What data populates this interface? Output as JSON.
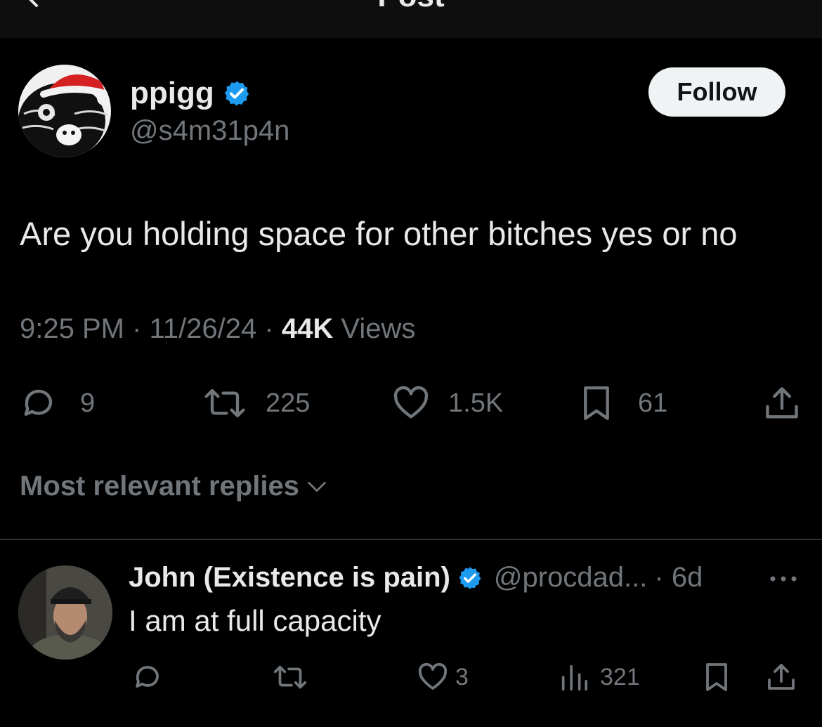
{
  "header": {
    "title": "Post"
  },
  "post": {
    "author_name": "ppigg",
    "author_handle": "@s4m31p4n",
    "follow_label": "Follow",
    "text": "Are you holding space for other bitches yes or no",
    "time": "9:25 PM",
    "date": "11/26/24",
    "views_count": "44K",
    "views_label": "Views",
    "separator": "·",
    "actions": {
      "replies": "9",
      "reposts": "225",
      "likes": "1.5K",
      "bookmarks": "61"
    }
  },
  "replies_sort": {
    "label": "Most relevant replies"
  },
  "reply": {
    "name": "John (Existence is pain)",
    "handle": "@procdad...",
    "age": "· 6d",
    "text": "I am at full capacity",
    "likes": "3",
    "views": "321"
  },
  "colors": {
    "background": "#000000",
    "text": "#e7e9ea",
    "muted": "#71767b",
    "verified": "#1d9bf0",
    "follow_bg": "#eff3f4"
  },
  "icons": [
    "back-arrow-icon",
    "verified-icon",
    "reply-icon",
    "repost-icon",
    "like-icon",
    "bookmark-icon",
    "share-icon",
    "chevron-down-icon",
    "more-icon",
    "views-icon"
  ]
}
